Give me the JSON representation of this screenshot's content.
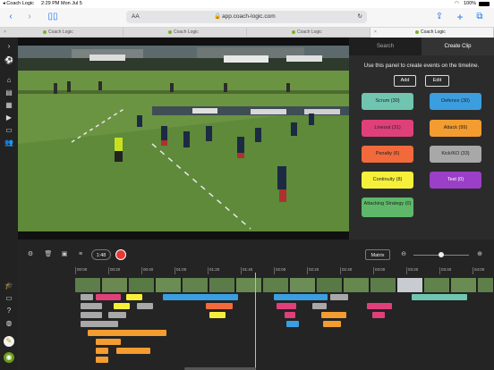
{
  "status": {
    "time": "2:29 PM",
    "date": "Mon Jul 5",
    "battery": "100%",
    "back_app": "Coach Logic"
  },
  "browser": {
    "aa_label": "AA",
    "url": "app.coach-logic.com",
    "tabs": [
      "Coach Logic",
      "Coach Logic",
      "Coach Logic",
      "Coach Logic"
    ]
  },
  "panel": {
    "tab_search": "Search",
    "tab_create": "Create Clip",
    "description": "Use this panel to create events on the timeline.",
    "add_label": "Add",
    "edit_label": "Edit",
    "code_buttons": [
      {
        "label": "Scrum (30)",
        "color": "#6fc5b0"
      },
      {
        "label": "Defence (30)",
        "color": "#3a9ee0"
      },
      {
        "label": "Lineout (31)",
        "color": "#e0407a"
      },
      {
        "label": "Attack (99)",
        "color": "#f39c30"
      },
      {
        "label": "Penalty (6)",
        "color": "#f26a3c"
      },
      {
        "label": "Kick/KO (33)",
        "color": "#a8a8a8"
      },
      {
        "label": "Continuity (8)",
        "color": "#f7f03a"
      },
      {
        "label": "Test (0)",
        "color": "#9b3fc8"
      },
      {
        "label": "Attacking Strategy (0)",
        "color": "#5fb86a"
      }
    ]
  },
  "timeline": {
    "speed_label": "1:48",
    "matrix_label": "Matrix",
    "ticks": [
      "00:00",
      "00:20",
      "00:40",
      "01:00",
      "01:20",
      "01:40",
      "02:00",
      "02:20",
      "02:40",
      "03:00",
      "03:20",
      "03:40",
      "04:00"
    ]
  }
}
